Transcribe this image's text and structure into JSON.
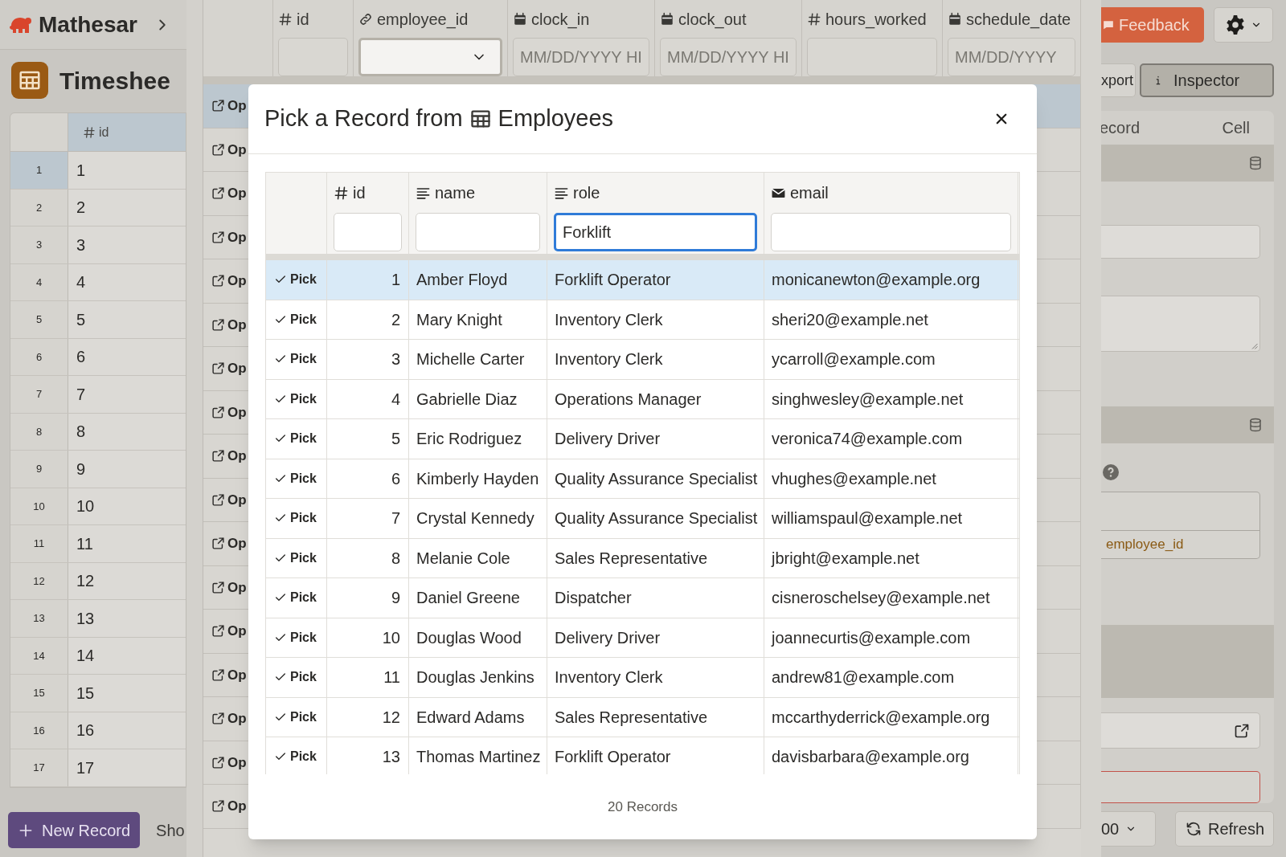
{
  "app": {
    "name": "Mathesar"
  },
  "table_title": "Timeshee",
  "left_table": {
    "column": "id",
    "rows": [
      {
        "number": "1",
        "id": "1",
        "selected": true
      },
      {
        "number": "2",
        "id": "2",
        "selected": false
      },
      {
        "number": "3",
        "id": "3",
        "selected": false
      },
      {
        "number": "4",
        "id": "4",
        "selected": false
      },
      {
        "number": "5",
        "id": "5",
        "selected": false
      },
      {
        "number": "6",
        "id": "6",
        "selected": false
      },
      {
        "number": "7",
        "id": "7",
        "selected": false
      },
      {
        "number": "8",
        "id": "8",
        "selected": false
      },
      {
        "number": "9",
        "id": "9",
        "selected": false
      },
      {
        "number": "10",
        "id": "10",
        "selected": false
      },
      {
        "number": "11",
        "id": "11",
        "selected": false
      },
      {
        "number": "12",
        "id": "12",
        "selected": false
      },
      {
        "number": "13",
        "id": "13",
        "selected": false
      },
      {
        "number": "14",
        "id": "14",
        "selected": false
      },
      {
        "number": "15",
        "id": "15",
        "selected": false
      },
      {
        "number": "16",
        "id": "16",
        "selected": false
      },
      {
        "number": "17",
        "id": "17",
        "selected": false
      }
    ]
  },
  "new_record_button": "New Record",
  "show_label": "Sho",
  "grid": {
    "columns": [
      {
        "name": "id",
        "kind": "number",
        "filter": {
          "kind": "text"
        }
      },
      {
        "name": "employee_id",
        "kind": "link",
        "filter": {
          "kind": "select"
        }
      },
      {
        "name": "clock_in",
        "kind": "date",
        "filter": {
          "kind": "text",
          "placeholder": "MM/DD/YYYY HI"
        }
      },
      {
        "name": "clock_out",
        "kind": "date",
        "filter": {
          "kind": "text",
          "placeholder": "MM/DD/YYYY HI"
        }
      },
      {
        "name": "hours_worked",
        "kind": "number",
        "filter": {
          "kind": "text"
        }
      },
      {
        "name": "schedule_date",
        "kind": "date",
        "filter": {
          "kind": "text",
          "placeholder": "MM/DD/YYYY"
        }
      }
    ],
    "rows": [
      {
        "open": "Op",
        "selected": true
      },
      {
        "open": "Op",
        "selected": false
      },
      {
        "open": "Op",
        "selected": false
      },
      {
        "open": "Op",
        "selected": false
      },
      {
        "open": "Op",
        "selected": false
      },
      {
        "open": "Op",
        "selected": false
      },
      {
        "open": "Op",
        "selected": false
      },
      {
        "open": "Op",
        "selected": false
      },
      {
        "open": "Op",
        "selected": false
      },
      {
        "open": "Op",
        "selected": false
      },
      {
        "open": "Op",
        "selected": false
      },
      {
        "open": "Op",
        "selected": false
      },
      {
        "open": "Op",
        "selected": false
      },
      {
        "open": "Op",
        "selected": false
      },
      {
        "open": "Op",
        "selected": false
      },
      {
        "open": "Op",
        "selected": false
      },
      {
        "open": "Op",
        "selected": false
      }
    ]
  },
  "right": {
    "feedback": "Feedback",
    "export": "xport",
    "inspector": "Inspector",
    "tabs": [
      "ecord",
      "Cell"
    ],
    "link_text": "employee_id",
    "page_size": "00",
    "refresh": "Refresh"
  },
  "dialog": {
    "title_prefix": "Pick a Record from",
    "table_name": "Employees",
    "columns": [
      {
        "name": "id",
        "kind": "number"
      },
      {
        "name": "name",
        "kind": "text"
      },
      {
        "name": "role",
        "kind": "text",
        "value": "Forklift"
      },
      {
        "name": "email",
        "kind": "email"
      }
    ],
    "rows": [
      {
        "pick": "Pick",
        "id": "1",
        "name": "Amber Floyd",
        "role": "Forklift Operator",
        "email": "monicanewton@example.org",
        "selected": true
      },
      {
        "pick": "Pick",
        "id": "2",
        "name": "Mary Knight",
        "role": "Inventory Clerk",
        "email": "sheri20@example.net",
        "selected": false
      },
      {
        "pick": "Pick",
        "id": "3",
        "name": "Michelle Carter",
        "role": "Inventory Clerk",
        "email": "ycarroll@example.com",
        "selected": false
      },
      {
        "pick": "Pick",
        "id": "4",
        "name": "Gabrielle Diaz",
        "role": "Operations Manager",
        "email": "singhwesley@example.net",
        "selected": false
      },
      {
        "pick": "Pick",
        "id": "5",
        "name": "Eric Rodriguez",
        "role": "Delivery Driver",
        "email": "veronica74@example.com",
        "selected": false
      },
      {
        "pick": "Pick",
        "id": "6",
        "name": "Kimberly Hayden",
        "role": "Quality Assurance Specialist",
        "email": "vhughes@example.net",
        "selected": false
      },
      {
        "pick": "Pick",
        "id": "7",
        "name": "Crystal Kennedy",
        "role": "Quality Assurance Specialist",
        "email": "williamspaul@example.net",
        "selected": false
      },
      {
        "pick": "Pick",
        "id": "8",
        "name": "Melanie Cole",
        "role": "Sales Representative",
        "email": "jbright@example.net",
        "selected": false
      },
      {
        "pick": "Pick",
        "id": "9",
        "name": "Daniel Greene",
        "role": "Dispatcher",
        "email": "cisneroschelsey@example.net",
        "selected": false
      },
      {
        "pick": "Pick",
        "id": "10",
        "name": "Douglas Wood",
        "role": "Delivery Driver",
        "email": "joannecurtis@example.com",
        "selected": false
      },
      {
        "pick": "Pick",
        "id": "11",
        "name": "Douglas Jenkins",
        "role": "Inventory Clerk",
        "email": "andrew81@example.com",
        "selected": false
      },
      {
        "pick": "Pick",
        "id": "12",
        "name": "Edward Adams",
        "role": "Sales Representative",
        "email": "mccarthyderrick@example.org",
        "selected": false
      },
      {
        "pick": "Pick",
        "id": "13",
        "name": "Thomas Martinez",
        "role": "Forklift Operator",
        "email": "davisbarbara@example.org",
        "selected": false
      }
    ],
    "footer": "20 Records"
  }
}
